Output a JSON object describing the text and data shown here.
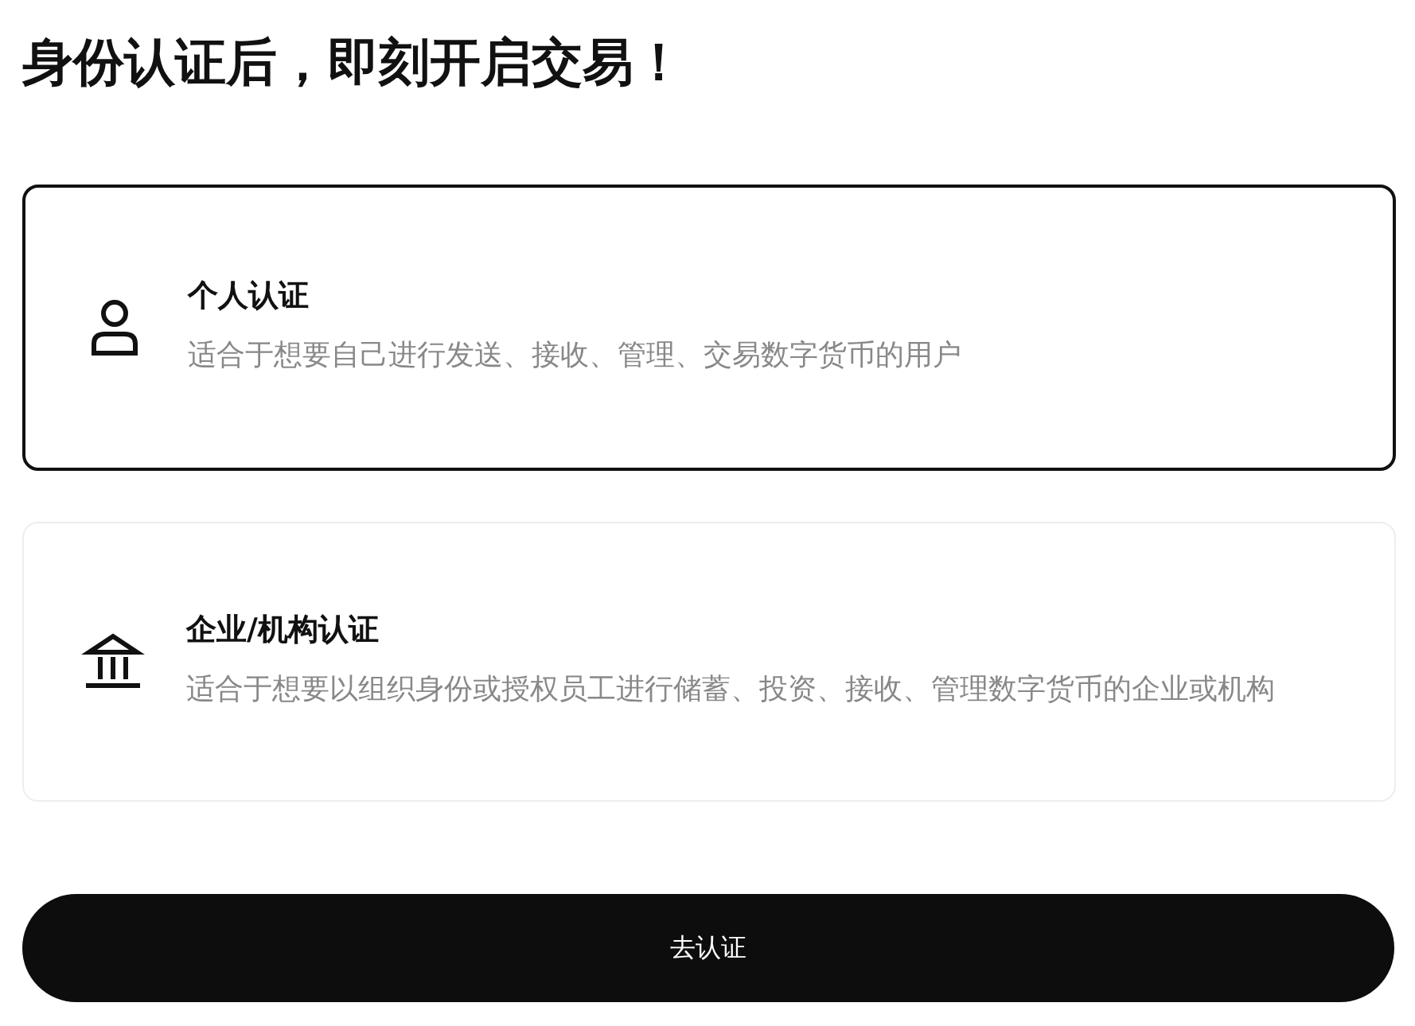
{
  "heading": "身份认证后，即刻开启交易！",
  "options": [
    {
      "kind": "person",
      "title": "个人认证",
      "description": "适合于想要自己进行发送、接收、管理、交易数字货币的用户",
      "selected": true
    },
    {
      "kind": "institution",
      "title": "企业/机构认证",
      "description": "适合于想要以组织身份或授权员工进行储蓄、投资、接收、管理数字货币的企业或机构",
      "selected": false
    }
  ],
  "button": "去认证"
}
